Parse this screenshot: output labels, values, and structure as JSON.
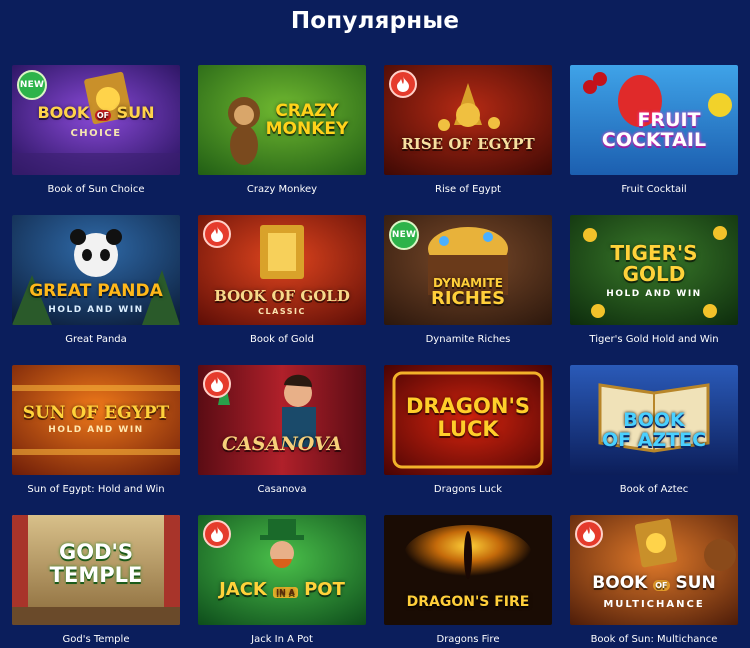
{
  "section": {
    "title": "Популярные"
  },
  "colors": {
    "background": "#0b1e5c",
    "new_badge": "#2db34a",
    "hot_badge": "#e53b2c"
  },
  "badges": {
    "new_label": "NEW",
    "hot_icon": "flame-icon"
  },
  "games": [
    {
      "title": "Book of Sun Choice",
      "badge": "new",
      "logo": {
        "top": "BOOK",
        "mid": "OF",
        "main": "SUN",
        "sub": "CHOICE"
      }
    },
    {
      "title": "Crazy Monkey",
      "badge": "",
      "logo": {
        "line1": "CRAZY",
        "line2": "MONKEY"
      }
    },
    {
      "title": "Rise of Egypt",
      "badge": "hot",
      "logo": {
        "line1": "RISE OF EGYPT"
      }
    },
    {
      "title": "Fruit Cocktail",
      "badge": "",
      "logo": {
        "line1": "FRUIT",
        "line2": "COCKTAIL"
      }
    },
    {
      "title": "Great Panda",
      "badge": "",
      "logo": {
        "line1": "GREAT PANDA",
        "sub": "HOLD AND WIN"
      }
    },
    {
      "title": "Book of Gold",
      "badge": "hot",
      "logo": {
        "line1": "BOOK OF GOLD",
        "sub": "CLASSIC"
      }
    },
    {
      "title": "Dynamite Riches",
      "badge": "new",
      "logo": {
        "line1": "DYNAMITE",
        "line2": "RICHES"
      }
    },
    {
      "title": "Tiger's Gold Hold and Win",
      "badge": "",
      "logo": {
        "line1": "TIGER'S",
        "line2": "GOLD",
        "sub": "HOLD AND WIN"
      }
    },
    {
      "title": "Sun of Egypt: Hold and Win",
      "badge": "",
      "logo": {
        "line1": "SUN OF EGYPT",
        "sub": "HOLD AND WIN"
      }
    },
    {
      "title": "Casanova",
      "badge": "hot",
      "logo": {
        "line1": "CASANOVA"
      }
    },
    {
      "title": "Dragons Luck",
      "badge": "",
      "logo": {
        "line1": "DRAGON'S",
        "line2": "LUCK"
      }
    },
    {
      "title": "Book of Aztec",
      "badge": "",
      "logo": {
        "line1": "BOOK",
        "line2": "OF AZTEC"
      }
    },
    {
      "title": "God's Temple",
      "badge": "",
      "logo": {
        "line1": "GOD'S",
        "line2": "TEMPLE"
      }
    },
    {
      "title": "Jack In A Pot",
      "badge": "hot",
      "logo": {
        "line1": "JACK",
        "mid": "IN A",
        "line2": "POT"
      }
    },
    {
      "title": "Dragons Fire",
      "badge": "",
      "logo": {
        "line1": "DRAGON'S FIRE"
      }
    },
    {
      "title": "Book of Sun: Multichance",
      "badge": "hot",
      "logo": {
        "top": "BOOK",
        "mid": "OF",
        "main": "SUN",
        "sub": "MULTICHANCE"
      }
    }
  ]
}
